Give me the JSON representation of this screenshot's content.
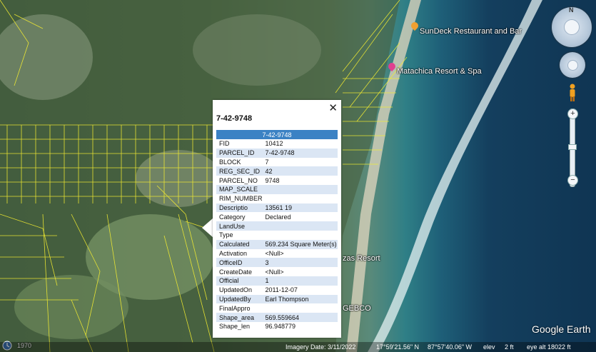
{
  "map": {
    "places": [
      {
        "name": "SunDeck Restaurant and Bar",
        "color": "#f0a030"
      },
      {
        "name": "Matachica Resort & Spa",
        "color": "#e04090"
      }
    ],
    "partial_labels": {
      "resort": "zas Resort",
      "gebco": "GEBCO"
    }
  },
  "balloon": {
    "title": "7-42-9748",
    "header": "7-42-9748",
    "close_symbol": "✕",
    "rows": [
      {
        "key": "FID",
        "value": "10412"
      },
      {
        "key": "PARCEL_ID",
        "value": "7-42-9748"
      },
      {
        "key": "BLOCK",
        "value": "7"
      },
      {
        "key": "REG_SEC_ID",
        "value": "42"
      },
      {
        "key": "PARCEL_NO",
        "value": "9748"
      },
      {
        "key": "MAP_SCALE",
        "value": ""
      },
      {
        "key": "RIM_NUMBER",
        "value": ""
      },
      {
        "key": "Descriptio",
        "value": "13561 19"
      },
      {
        "key": "Category",
        "value": "Declared"
      },
      {
        "key": "LandUse",
        "value": ""
      },
      {
        "key": "Type",
        "value": ""
      },
      {
        "key": "Calculated",
        "value": "569.234 Square Meter(s)"
      },
      {
        "key": "Activation",
        "value": "<Null>"
      },
      {
        "key": "OfficeID",
        "value": "3"
      },
      {
        "key": "CreateDate",
        "value": "<Null>"
      },
      {
        "key": "Official",
        "value": "1"
      },
      {
        "key": "UpdatedOn",
        "value": "2011-12-07"
      },
      {
        "key": "UpdatedBy",
        "value": "Earl Thompson"
      },
      {
        "key": "FinalAppro",
        "value": ""
      },
      {
        "key": "Shape_area",
        "value": "569.559664"
      },
      {
        "key": "Shape_len",
        "value": "96.948779"
      }
    ]
  },
  "controls": {
    "compass_letter": "N",
    "zoom_in": "+",
    "zoom_out": "−"
  },
  "status": {
    "year": "1970",
    "imagery_date": "Imagery Date: 3/11/2022",
    "lat": "17°59'21.56\" N",
    "lon": "87°57'40.06\" W",
    "elev_label": "elev",
    "elev_value": "2 ft",
    "eye_alt": "eye alt  18022 ft"
  },
  "logo": "Google Earth"
}
